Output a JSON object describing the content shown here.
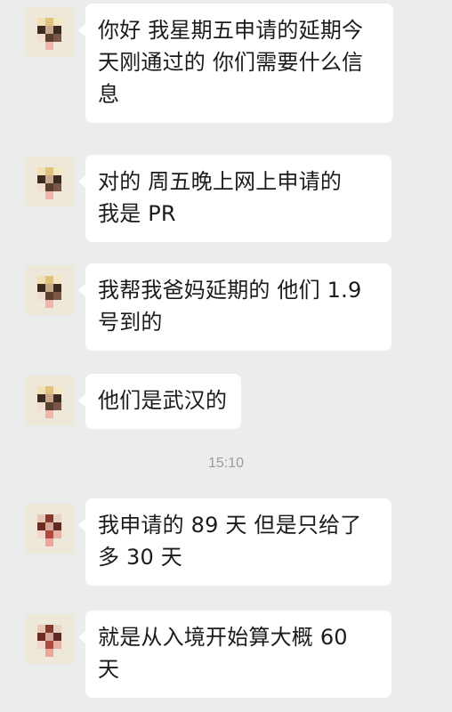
{
  "messages": [
    {
      "text": "你好 我星期五申请的延期今\n天刚通过的 你们需要什么信\n息"
    },
    {
      "text": "对的 周五晚上网上申请的\n我是 PR"
    },
    {
      "text": "我帮我爸妈延期的 他们 1.9\n号到的"
    },
    {
      "text": "他们是武汉的"
    },
    {
      "text": "我申请的 89 天 但是只给了\n多 30 天"
    },
    {
      "text": "就是从入境开始算大概 60\n天"
    }
  ],
  "timestamp": "15:10"
}
